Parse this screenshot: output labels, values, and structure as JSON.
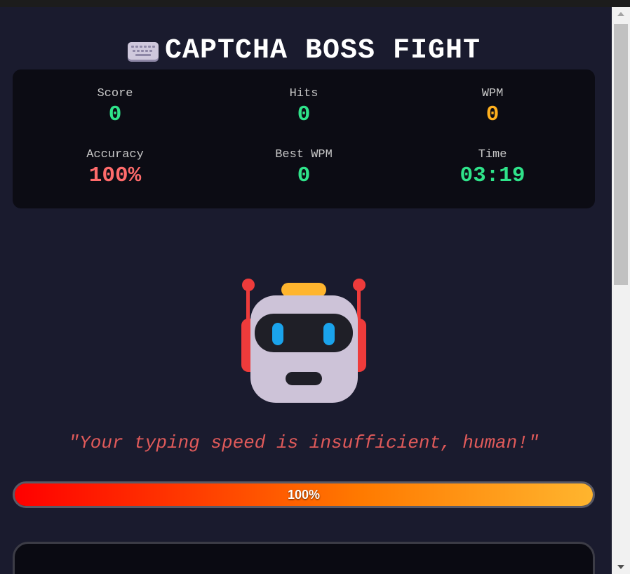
{
  "title": {
    "icon": "keyboard-icon",
    "text": "CAPTCHA BOSS FIGHT"
  },
  "stats": {
    "score": {
      "label": "Score",
      "value": "0",
      "color": "#2fe38a"
    },
    "hits": {
      "label": "Hits",
      "value": "0",
      "color": "#2fe38a"
    },
    "wpm": {
      "label": "WPM",
      "value": "0",
      "color": "#ffb01e"
    },
    "accuracy": {
      "label": "Accuracy",
      "value": "100%",
      "color": "#ff6b6b"
    },
    "best_wpm": {
      "label": "Best WPM",
      "value": "0",
      "color": "#2fe38a"
    },
    "time": {
      "label": "Time",
      "value": "03:19",
      "color": "#2fe38a"
    }
  },
  "boss": {
    "icon": "robot-icon",
    "taunt": "\"Your typing speed is insufficient, human!\""
  },
  "health": {
    "label": "100%",
    "level": 1.0
  }
}
